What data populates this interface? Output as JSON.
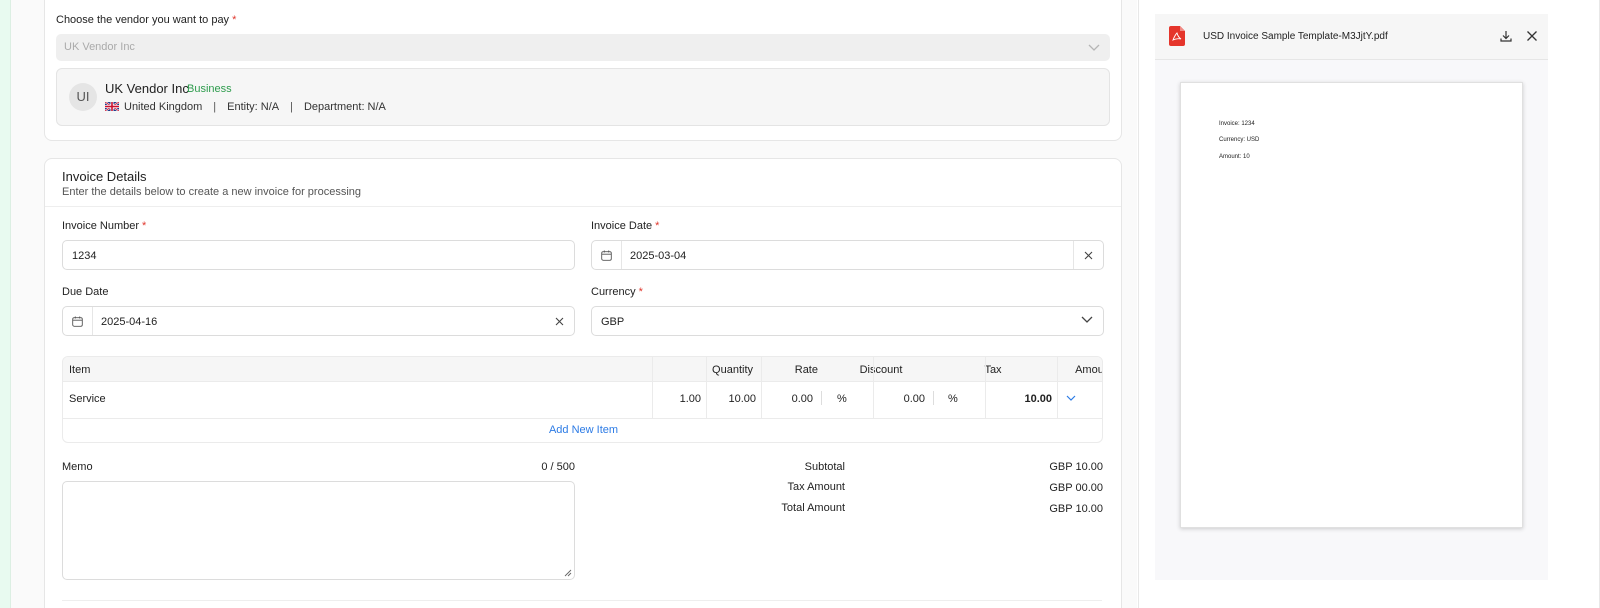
{
  "vendor": {
    "prompt": "Choose the vendor you want to pay",
    "required_mark": "*",
    "selected": "UK Vendor Inc",
    "card": {
      "initials": "UI",
      "name": "UK Vendor Inc",
      "type": "Business",
      "country": "United Kingdom",
      "entity": "Entity: N/A",
      "department": "Department: N/A",
      "separator": "|"
    }
  },
  "invoice": {
    "title": "Invoice Details",
    "subtitle": "Enter the details below to create a new invoice for processing",
    "fields": {
      "invoice_number": {
        "label": "Invoice Number",
        "value": "1234"
      },
      "invoice_date": {
        "label": "Invoice Date",
        "value": "2025-03-04"
      },
      "due_date": {
        "label": "Due Date",
        "value": "2025-04-16"
      },
      "currency": {
        "label": "Currency",
        "value": "GBP"
      }
    },
    "table": {
      "headers": [
        "Item",
        "Quantity",
        "Rate",
        "Discount",
        "Tax",
        "Amount"
      ],
      "rows": [
        {
          "item": "Service",
          "quantity": "1.00",
          "rate": "10.00",
          "discount": "0.00",
          "discount_unit": "%",
          "tax": "0.00",
          "tax_unit": "%",
          "amount": "10.00"
        }
      ],
      "add_item": "Add New Item"
    },
    "memo": {
      "label": "Memo",
      "counter": "0 / 500",
      "value": ""
    },
    "totals": {
      "subtotal_label": "Subtotal",
      "subtotal": "GBP 10.00",
      "tax_label": "Tax Amount",
      "tax": "GBP 00.00",
      "total_label": "Total Amount",
      "total": "GBP 10.00"
    }
  },
  "preview": {
    "file_name": "USD Invoice Sample Template-M3JjtY.pdf",
    "lines": [
      "Invoice: 1234",
      "Currency: USD",
      "Amount: 10"
    ]
  },
  "colors": {
    "required": "#e0362c",
    "business": "#2e9c4d",
    "link": "#2c7be5",
    "pdf": "#e5352b",
    "left_strip": "#e8faf0"
  }
}
